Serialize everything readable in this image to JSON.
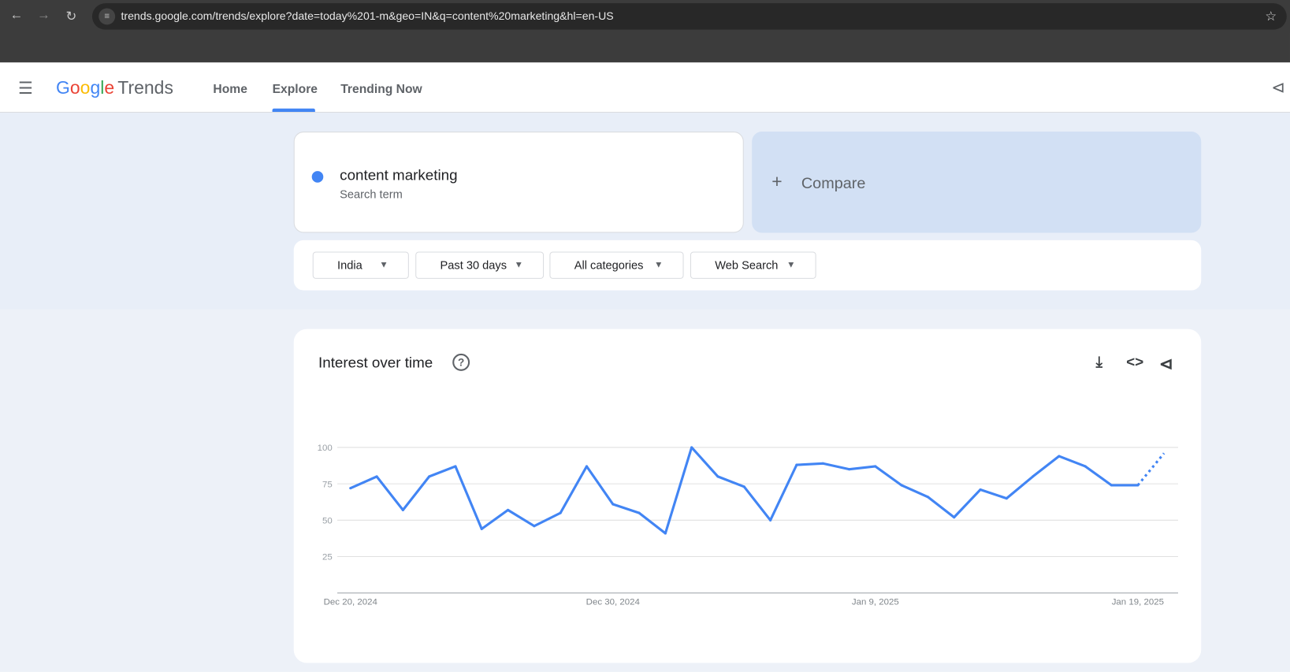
{
  "browser": {
    "url": "trends.google.com/trends/explore?date=today%201-m&geo=IN&q=content%20marketing&hl=en-US"
  },
  "header": {
    "logo_google": "Google",
    "logo_trends": "Trends",
    "tabs": [
      {
        "label": "Home"
      },
      {
        "label": "Explore",
        "active": true
      },
      {
        "label": "Trending Now"
      }
    ]
  },
  "search": {
    "term": "content marketing",
    "term_type": "Search term",
    "term_color": "#4285f4",
    "compare_label": "Compare"
  },
  "filters": {
    "region": "India",
    "period": "Past 30 days",
    "category": "All categories",
    "property": "Web Search"
  },
  "chart_card": {
    "title": "Interest over time"
  },
  "chart_data": {
    "type": "line",
    "title": "Interest over time",
    "ylim": [
      0,
      100
    ],
    "yticks": [
      "100",
      "75",
      "50",
      "25"
    ],
    "xtick_labels": [
      "Dec 20, 2024",
      "Dec 30, 2024",
      "Jan 9, 2025",
      "Jan 19, 2025"
    ],
    "series": [
      {
        "name": "content marketing",
        "color": "#4285f4",
        "values": [
          72,
          80,
          57,
          80,
          87,
          44,
          57,
          46,
          55,
          87,
          61,
          55,
          41,
          100,
          80,
          73,
          50,
          88,
          89,
          85,
          87,
          74,
          66,
          52,
          71,
          65,
          80,
          94,
          87,
          74,
          74
        ],
        "partial_next_value": 96
      }
    ],
    "x_start": "Dec 20, 2024",
    "x_end": "Jan 19, 2025"
  }
}
